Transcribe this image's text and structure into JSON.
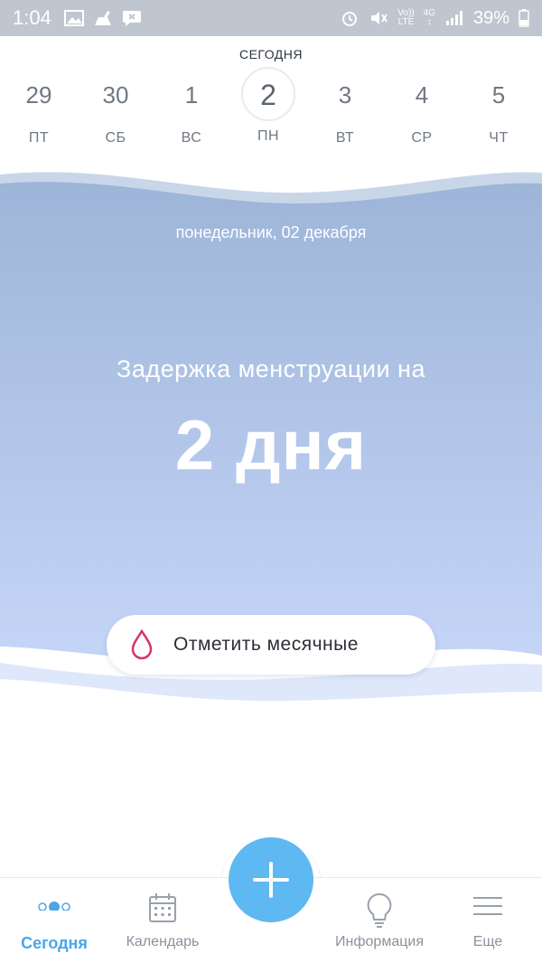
{
  "status_bar": {
    "time": "1:04",
    "net_top": "Vo))",
    "net_bottom": "LTE",
    "gen_top": "4G",
    "gen_bottom": "↕",
    "battery": "39%"
  },
  "week": {
    "today_label": "СЕГОДНЯ",
    "days": [
      {
        "num": "29",
        "name": "ПТ"
      },
      {
        "num": "30",
        "name": "СБ"
      },
      {
        "num": "1",
        "name": "ВС"
      },
      {
        "num": "2",
        "name": "ПН",
        "selected": true
      },
      {
        "num": "3",
        "name": "ВТ"
      },
      {
        "num": "4",
        "name": "СР"
      },
      {
        "num": "5",
        "name": "ЧТ"
      }
    ]
  },
  "hero": {
    "date": "понедельник, 02 декабря",
    "subtitle": "Задержка менструации на",
    "big": "2 дня",
    "mark_button": "Отметить месячные"
  },
  "nav": {
    "items": [
      {
        "label": "Сегодня",
        "icon": "today-dots-icon",
        "active": true
      },
      {
        "label": "Календарь",
        "icon": "calendar-icon"
      },
      {
        "label": "Информация",
        "icon": "lightbulb-icon"
      },
      {
        "label": "Еще",
        "icon": "menu-icon"
      }
    ],
    "fab_icon": "plus-icon"
  },
  "colors": {
    "accent": "#5eb8f2",
    "hero_top": "#9fb7d9",
    "hero_bottom": "#c3d3f7",
    "drop": "#d6336c"
  }
}
